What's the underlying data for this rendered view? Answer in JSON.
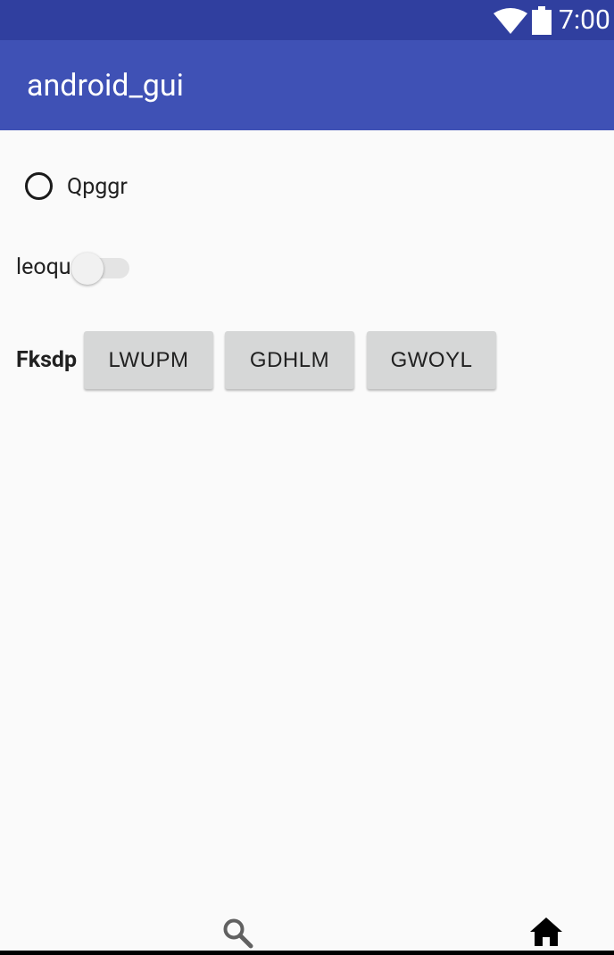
{
  "status_bar": {
    "time": "7:00",
    "icons": [
      "wifi-icon",
      "battery-icon"
    ],
    "color": "#303f9f"
  },
  "app_bar": {
    "title": "android_gui",
    "color": "#3f51b5"
  },
  "radio": {
    "label": "Qpggr",
    "checked": false
  },
  "switch": {
    "label": "leoqu",
    "on": false
  },
  "button_group": {
    "label": "Fksdp",
    "buttons": [
      "LWUPM",
      "GDHLM",
      "GWOYL"
    ]
  },
  "bottom_nav": {
    "icons": [
      "search-icon",
      "home-icon"
    ]
  }
}
